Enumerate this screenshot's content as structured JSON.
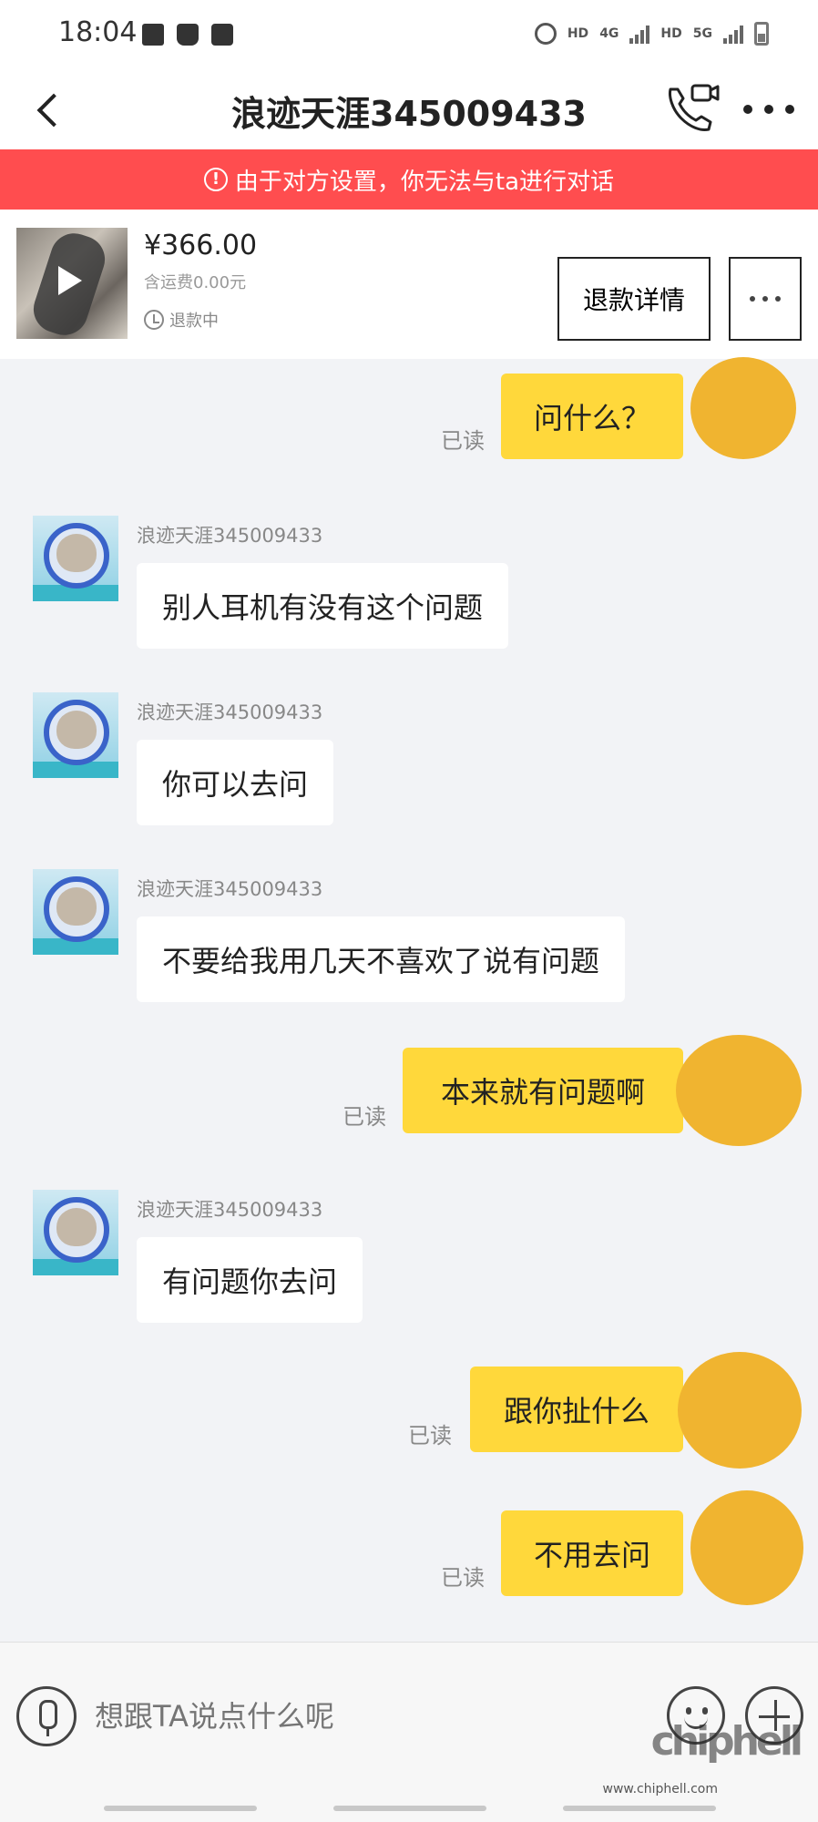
{
  "status_bar": {
    "time": "18:04",
    "hd1": "HD",
    "hd2": "HD",
    "net1": "4G",
    "net2": "5G"
  },
  "header": {
    "title": "浪迹天涯345009433"
  },
  "banner": {
    "text": "由于对方设置，你无法与ta进行对话"
  },
  "product": {
    "price": "¥366.00",
    "shipping": "含运费0.00元",
    "status": "退款中",
    "refund_button": "退款详情"
  },
  "messages": [
    {
      "type": "out",
      "text": "问什么？",
      "read": "已读"
    },
    {
      "type": "in",
      "sender": "浪迹天涯345009433",
      "text": "别人耳机有没有这个问题"
    },
    {
      "type": "in",
      "sender": "浪迹天涯345009433",
      "text": "你可以去问"
    },
    {
      "type": "in",
      "sender": "浪迹天涯345009433",
      "text": "不要给我用几天不喜欢了说有问题"
    },
    {
      "type": "out",
      "text": "本来就有问题啊",
      "read": "已读"
    },
    {
      "type": "in",
      "sender": "浪迹天涯345009433",
      "text": "有问题你去问"
    },
    {
      "type": "out",
      "text": "跟你扯什么",
      "read": "已读"
    },
    {
      "type": "out",
      "text": "不用去问",
      "read": "已读"
    }
  ],
  "input": {
    "placeholder": "想跟TA说点什么呢"
  },
  "watermark": {
    "logo": "chiphell",
    "url": "www.chiphell.com"
  },
  "colors": {
    "banner": "#ff4d4f",
    "bubble_out": "#ffd83b",
    "background": "#f2f3f6"
  }
}
